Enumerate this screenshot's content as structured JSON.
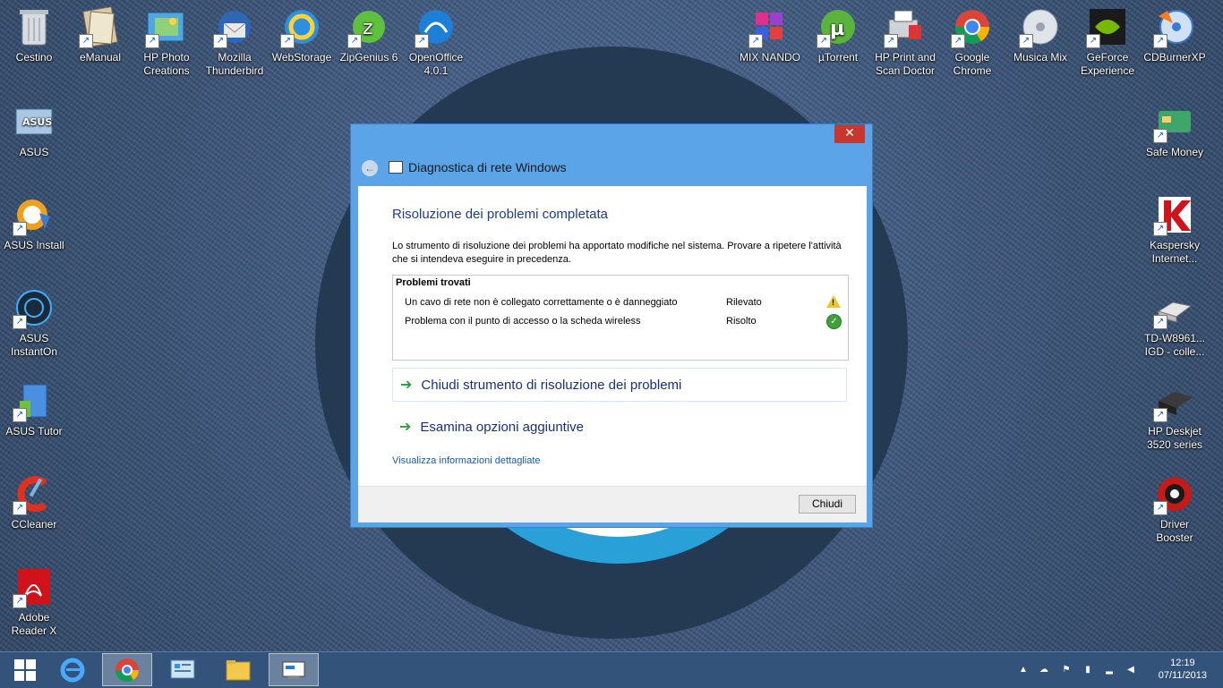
{
  "desktop": {
    "icons_top": [
      {
        "label": "Cestino",
        "icon": "recycle-bin-icon"
      },
      {
        "label": "eManual",
        "icon": "emanual-icon"
      },
      {
        "label": "HP Photo Creations",
        "icon": "hp-photo-icon"
      },
      {
        "label": "Mozilla Thunderbird",
        "icon": "thunderbird-icon"
      },
      {
        "label": "WebStorage",
        "icon": "webstorage-icon"
      },
      {
        "label": "ZipGenius 6",
        "icon": "zipgenius-icon"
      },
      {
        "label": "OpenOffice 4.0.1",
        "icon": "openoffice-icon"
      },
      {
        "label": "MIX NANDO",
        "icon": "mix-nando-icon"
      },
      {
        "label": "µTorrent",
        "icon": "utorrent-icon"
      },
      {
        "label": "HP Print and Scan Doctor",
        "icon": "hp-print-icon"
      },
      {
        "label": "Google Chrome",
        "icon": "chrome-icon"
      },
      {
        "label": "Musica Mix",
        "icon": "musica-mix-icon"
      },
      {
        "label": "GeForce Experience",
        "icon": "geforce-icon"
      },
      {
        "label": "CDBurnerXP",
        "icon": "cdburner-icon"
      }
    ],
    "icons_left": [
      {
        "label": "ASUS",
        "icon": "asus-icon"
      },
      {
        "label": "ASUS Install",
        "icon": "asus-install-icon"
      },
      {
        "label": "ASUS InstantOn",
        "icon": "asus-instanton-icon"
      },
      {
        "label": "ASUS Tutor",
        "icon": "asus-tutor-icon"
      },
      {
        "label": "CCleaner",
        "icon": "ccleaner-icon"
      },
      {
        "label": "Adobe Reader X",
        "icon": "adobe-reader-icon"
      }
    ],
    "icons_right": [
      {
        "label": "Safe Money",
        "icon": "safe-money-icon"
      },
      {
        "label": "Kaspersky Internet...",
        "icon": "kaspersky-icon"
      },
      {
        "label": "TD-W8961... IGD - colle...",
        "icon": "router-icon"
      },
      {
        "label": "HP Deskjet 3520 series",
        "icon": "printer-icon"
      },
      {
        "label": "Driver Booster",
        "icon": "driver-booster-icon"
      }
    ]
  },
  "dialog": {
    "title": "Diagnostica di rete Windows",
    "close_glyph": "✕",
    "heading": "Risoluzione dei problemi completata",
    "description": "Lo strumento di risoluzione dei problemi ha apportato modifiche nel sistema. Provare a ripetere l'attività che si intendeva eseguire in precedenza.",
    "problems_title": "Problemi trovati",
    "problems": [
      {
        "name": "Un cavo di rete non è collegato correttamente o è danneggiato",
        "status": "Rilevato",
        "icon": "warning-icon"
      },
      {
        "name": "Problema con il punto di accesso o la scheda wireless",
        "status": "Risolto",
        "icon": "check-icon"
      }
    ],
    "action_close": "Chiudi strumento di risoluzione dei problemi",
    "action_more": "Esamina opzioni aggiuntive",
    "details_link": "Visualizza informazioni dettagliate",
    "close_button": "Chiudi"
  },
  "taskbar": {
    "time": "12:19",
    "date": "07/11/2013"
  }
}
